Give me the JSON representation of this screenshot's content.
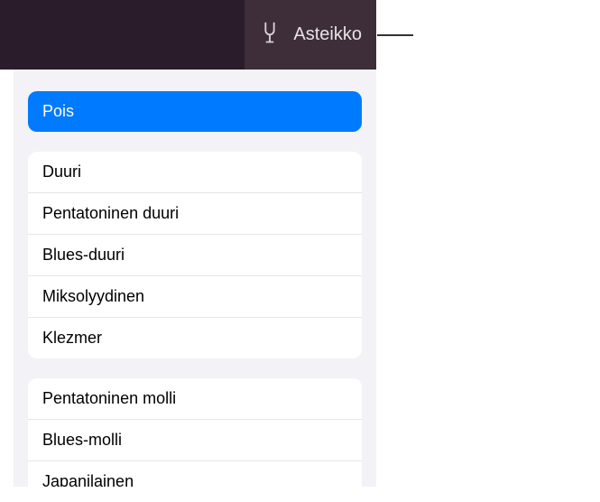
{
  "header": {
    "button_label": "Asteikko"
  },
  "groups": [
    {
      "items": [
        {
          "label": "Pois",
          "selected": true
        }
      ]
    },
    {
      "items": [
        {
          "label": "Duuri",
          "selected": false
        },
        {
          "label": "Pentatoninen duuri",
          "selected": false
        },
        {
          "label": "Blues-duuri",
          "selected": false
        },
        {
          "label": "Miksolyydinen",
          "selected": false
        },
        {
          "label": "Klezmer",
          "selected": false
        }
      ]
    },
    {
      "items": [
        {
          "label": "Pentatoninen molli",
          "selected": false
        },
        {
          "label": "Blues-molli",
          "selected": false
        },
        {
          "label": "Japanilainen",
          "selected": false
        }
      ]
    }
  ]
}
